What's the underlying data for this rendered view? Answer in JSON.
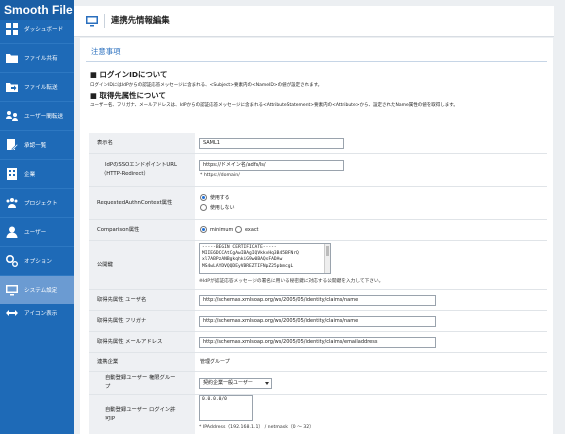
{
  "app": {
    "logo": "Smooth File"
  },
  "sidebar": {
    "items": [
      {
        "label": "ダッシュボード",
        "icon": "dashboard-icon"
      },
      {
        "label": "ファイル共有",
        "icon": "folder-icon"
      },
      {
        "label": "ファイル転送",
        "icon": "folder-transfer-icon"
      },
      {
        "label": "ユーザー間転送",
        "icon": "user-transfer-icon"
      },
      {
        "label": "承認一覧",
        "icon": "approval-icon"
      },
      {
        "label": "企業",
        "icon": "building-icon"
      },
      {
        "label": "プロジェクト",
        "icon": "project-icon"
      },
      {
        "label": "ユーザー",
        "icon": "user-icon"
      },
      {
        "label": "オプション",
        "icon": "gears-icon"
      },
      {
        "label": "システム設定",
        "icon": "system-settings-icon"
      },
      {
        "label": "アイコン表示",
        "icon": "collapse-arrows-icon"
      }
    ]
  },
  "header": {
    "title": "連携先情報編集"
  },
  "notice": {
    "title": "注意事項",
    "login_heading": "■ ログインIDについて",
    "login_desc": "ログインIDにはIdPからの認証応答メッセージに含まれる、<Subject>要素内の<NameID>の値が設定されます。",
    "attr_heading": "■ 取得先属性について",
    "attr_desc": "ユーザー名、フリガナ、メールアドレスは、IdPからの認証応答メッセージに含まれる<AttributeStatement>要素内の<Attribute>から、設定されたName属性の値を取得します。"
  },
  "form": {
    "display_name": {
      "label": "表示名",
      "value": "SAML1"
    },
    "sso_url": {
      "label1": "IdPのSSOエンドポイントURL",
      "label2": "（HTTP-Redirect）",
      "value": "https://ドメイン名/adfs/ls/",
      "note": "* https://domain/"
    },
    "authn_context": {
      "label": "RequestedAuthnContext属性",
      "option_use": "使用する",
      "option_nouse": "使用しない"
    },
    "comparison": {
      "label": "Comparison属性",
      "option_min": "minimum",
      "option_exact": "exact"
    },
    "public_key": {
      "label": "公開鍵",
      "line1": "-----BEGIN CERTIFICATE-----",
      "line2": "MIIE6DCCAtCgAwIBAgIQVkkvHq3B45BFNrQ",
      "line3": "xl7ABPzANBgkqhkiG9w0BAQsFADAw",
      "line4": "MS4wLAYDVQQDEyVBREZTIFNpZ25pbmcgL",
      "note": "※IdPが認証応答メッセージの署名に用いる秘密鍵に対応する公開鍵を入力して下さい。"
    },
    "attr_username": {
      "label": "取得先属性 ユーザ名",
      "value": "http://schemas.xmlsoap.org/ws/2005/05/identity/claims/name"
    },
    "attr_kana": {
      "label": "取得先属性 フリガナ",
      "value": "http://schemas.xmlsoap.org/ws/2005/05/identity/claims/name"
    },
    "attr_email": {
      "label": "取得先属性 メールアドレス",
      "value": "http://schemas.xmlsoap.org/ws/2005/05/identity/claims/emailaddress"
    },
    "company": {
      "label": "連携企業",
      "value": "管理グループ"
    },
    "auto_group": {
      "label1": "自動登録ユーザー 権限グルー",
      "label2": "プ",
      "selected": "契約企業一般ユーザー"
    },
    "auto_ip": {
      "label1": "自動登録ユーザー ログイン許",
      "label2": "可IP",
      "value": "0.0.0.0/0",
      "note": "* IPAddress（192.168.1.1） / netmask（0 ～ 32）"
    }
  }
}
